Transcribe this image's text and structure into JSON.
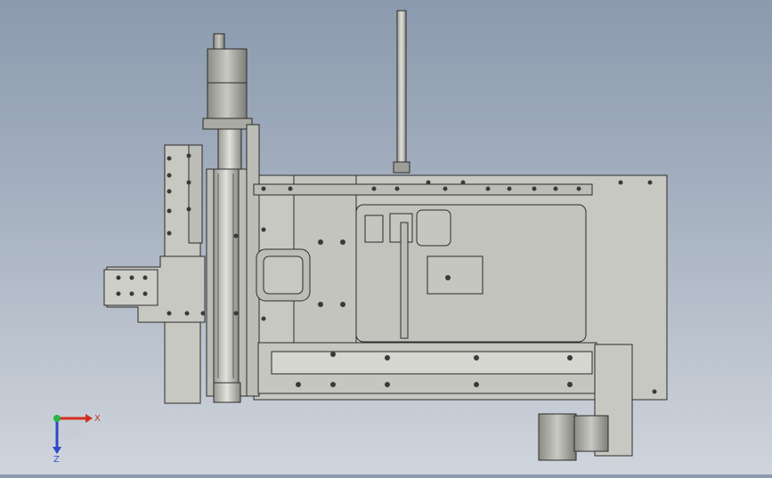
{
  "viewport": {
    "background_top": "#8b9aae",
    "background_bottom": "#d0d5dc",
    "part_fill": "#c8c8c2",
    "part_dark": "#9e9e98",
    "edge_color": "#2b2b2b"
  },
  "triad": {
    "x_label": "X",
    "y_label": "",
    "z_label": "Z",
    "x_color": "#d62d20",
    "y_color": "#2bb34a",
    "z_color": "#2f47c9"
  }
}
